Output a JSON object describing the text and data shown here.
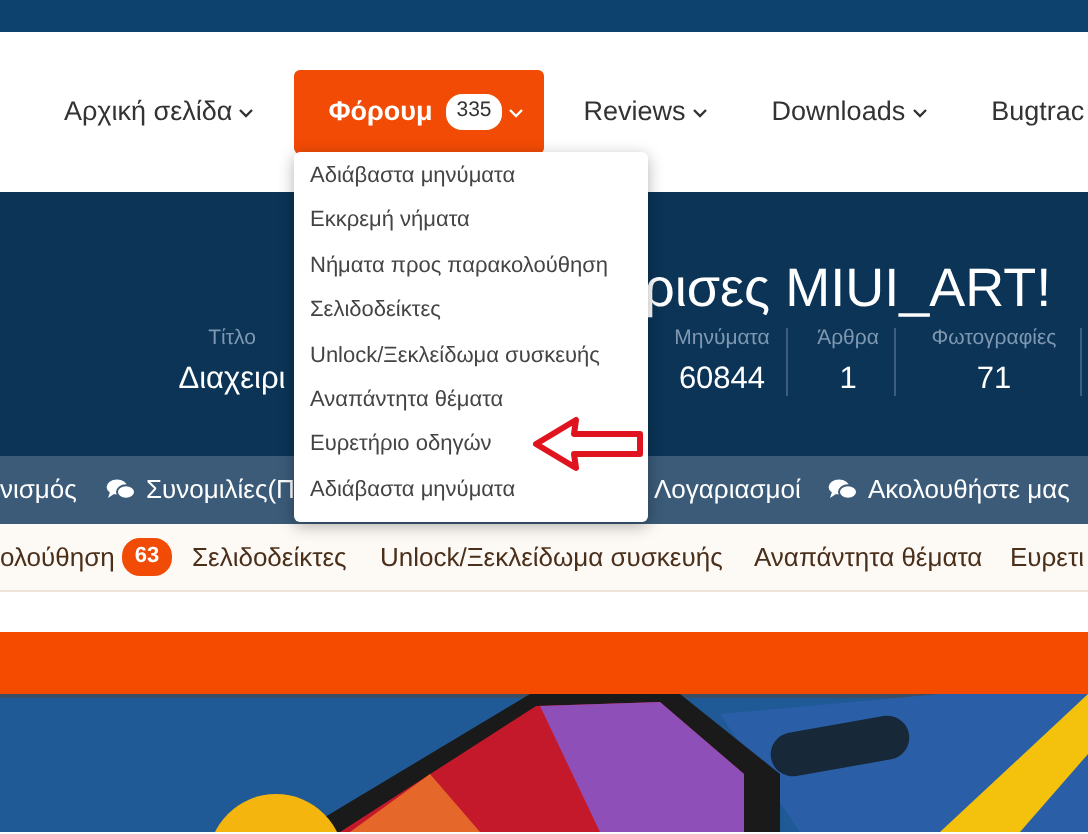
{
  "top_nav": [
    {
      "label": "Αρχική σελίδα",
      "selected": false
    },
    {
      "label": "Φόρουμ",
      "badge": "335",
      "selected": true
    },
    {
      "label": "Reviews",
      "selected": false
    },
    {
      "label": "Downloads",
      "selected": false
    },
    {
      "label": "Bugtrac",
      "selected": false
    }
  ],
  "dropdown": {
    "items": [
      {
        "label": "Αδιάβαστα μηνύματα",
        "annotated": false
      },
      {
        "label": "Εκκρεμή νήματα",
        "annotated": false
      },
      {
        "label": "Νήματα προς παρακολούθηση",
        "annotated": false
      },
      {
        "label": "Σελιδοδείκτες",
        "annotated": false
      },
      {
        "label": "Unlock/Ξεκλείδωμα συσκευής",
        "annotated": false
      },
      {
        "label": "Αναπάντητα θέματα",
        "annotated": false
      },
      {
        "label": "Ευρετήριο οδηγών",
        "annotated": true
      },
      {
        "label": "Αδιάβαστα μηνύματα",
        "annotated": false
      }
    ]
  },
  "hero": {
    "title": "ρισες MIUI_ART!",
    "stats": [
      {
        "label": "Τίτλο",
        "value": "Διαχειρι"
      },
      {
        "label": "Μηνύματα",
        "value": "60844"
      },
      {
        "label": "Άρθρα",
        "value": "1"
      },
      {
        "label": "Φωτογραφίες",
        "value": "71"
      }
    ]
  },
  "section_nav": [
    {
      "label": "νισμός",
      "kind": "text"
    },
    {
      "label": "Συνομιλίες(Π",
      "kind": "chat"
    },
    {
      "label": "Λογαριασμοί",
      "kind": "text"
    },
    {
      "label": "Ακολουθήστε μας",
      "kind": "chat"
    }
  ],
  "sub_nav": [
    {
      "label": "ολούθηση",
      "badge": "63"
    },
    {
      "label": "Σελιδοδείκτες"
    },
    {
      "label": "Unlock/Ξεκλείδωμα συσκευής"
    },
    {
      "label": "Αναπάντητα θέματα"
    },
    {
      "label": "Ευρετι"
    }
  ]
}
